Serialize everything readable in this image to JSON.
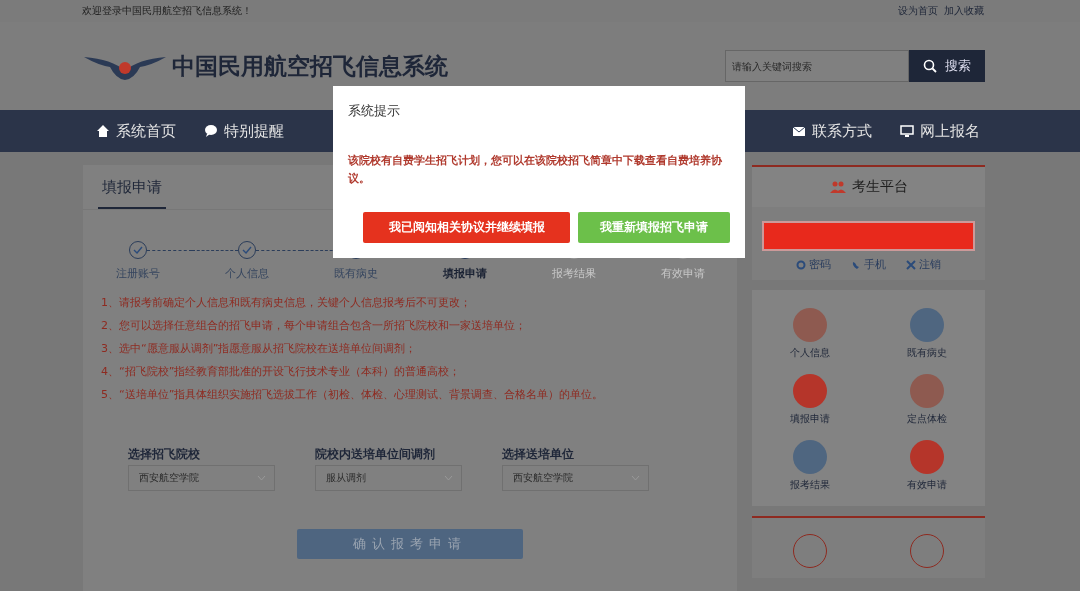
{
  "top_bar": {
    "welcome": "欢迎登录中国民用航空招飞信息系统！",
    "links": [
      "设为首页",
      "加入收藏"
    ]
  },
  "header": {
    "site_title": "中国民用航空招飞信息系统",
    "search": {
      "placeholder": "请输入关键词搜索",
      "button": "搜索"
    }
  },
  "nav": {
    "items_left": [
      "系统首页",
      "特别提醒"
    ],
    "items_right": [
      "联系方式",
      "网上报名"
    ]
  },
  "main": {
    "title": "填报申请",
    "steps": [
      {
        "label": "注册账号",
        "selected": false,
        "disabled": false
      },
      {
        "label": "个人信息",
        "selected": false,
        "disabled": false
      },
      {
        "label": "既有病史",
        "selected": false,
        "disabled": false
      },
      {
        "label": "填报申请",
        "selected": true,
        "disabled": false
      },
      {
        "label": "报考结果",
        "selected": false,
        "disabled": true
      },
      {
        "label": "有效申请",
        "selected": false,
        "disabled": true
      }
    ],
    "notes": [
      "1、请报考前确定个人信息和既有病史信息，关键个人信息报考后不可更改；",
      "2、您可以选择任意组合的招飞申请，每个申请组合包含一所招飞院校和一家送培单位；",
      "3、选中“愿意服从调剂”指愿意服从招飞院校在送培单位间调剂；",
      "4、“招飞院校”指经教育部批准的开设飞行技术专业（本科）的普通高校；",
      "5、“送培单位”指具体组织实施招飞选拔工作（初检、体检、心理测试、背景调查、合格名单）的单位。"
    ],
    "selects": [
      {
        "label": "选择招飞院校",
        "value": "西安航空学院"
      },
      {
        "label": "院校内送培单位间调剂",
        "value": "服从调剂"
      },
      {
        "label": "选择送培单位",
        "value": "西安航空学院"
      }
    ],
    "submit": "确认报考申请"
  },
  "sidebar": {
    "title": "考生平台",
    "links": [
      "密码",
      "手机",
      "注销"
    ],
    "tiles": [
      {
        "label": "个人信息",
        "color": "#8e5a50"
      },
      {
        "label": "既有病史",
        "color": "#4f6680"
      },
      {
        "label": "填报申请",
        "color": "#b5352a"
      },
      {
        "label": "定点体检",
        "color": "#8e5a50"
      },
      {
        "label": "报考结果",
        "color": "#4f6680"
      },
      {
        "label": "有效申请",
        "color": "#b5352a"
      }
    ]
  },
  "dialog": {
    "title": "系统提示",
    "message": "该院校有自费学生招飞计划，您可以在该院校招飞简章中下载查看自费培养协议。",
    "buttons": [
      {
        "label": "我已阅知相关协议并继续填报",
        "kind": "danger"
      },
      {
        "label": "我重新填报招飞申请",
        "kind": "success"
      }
    ]
  }
}
